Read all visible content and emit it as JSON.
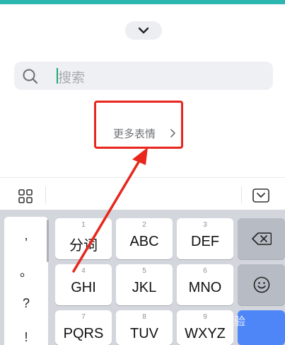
{
  "search": {
    "placeholder": "搜索"
  },
  "more_stickers": {
    "label": "更多表情"
  },
  "toolbar": {
    "grid_icon": "grid-icon",
    "hide_icon": "keyboard-hide-icon"
  },
  "punctuation": [
    ",",
    "。",
    "?",
    "!"
  ],
  "keys": [
    {
      "num": "1",
      "label": "分词"
    },
    {
      "num": "2",
      "label": "ABC"
    },
    {
      "num": "3",
      "label": "DEF"
    },
    {
      "num": "4",
      "label": "GHI"
    },
    {
      "num": "5",
      "label": "JKL"
    },
    {
      "num": "6",
      "label": "MNO"
    },
    {
      "num": "7",
      "label": "PQRS"
    },
    {
      "num": "8",
      "label": "TUV"
    },
    {
      "num": "9",
      "label": "WXYZ"
    }
  ],
  "watermark": "经验",
  "colors": {
    "accent": "#2bb6b0",
    "highlight": "#e8261c",
    "enter": "#4f86f7"
  }
}
